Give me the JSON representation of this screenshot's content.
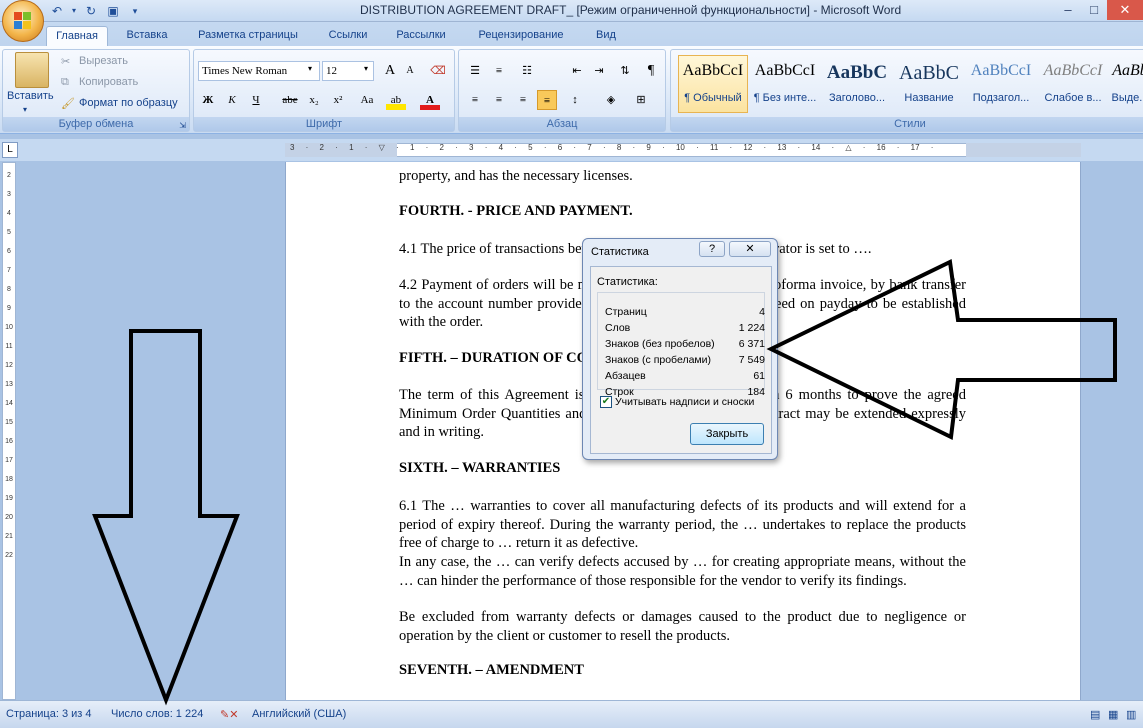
{
  "window": {
    "title": "DISTRIBUTION AGREEMENT DRAFT_ [Режим ограниченной функциональности] - Microsoft Word",
    "minimize_glyph": "–",
    "maximize_glyph": "□",
    "close_glyph": "✕"
  },
  "ribbon_tabs": [
    "Главная",
    "Вставка",
    "Разметка страницы",
    "Ссылки",
    "Рассылки",
    "Рецензирование",
    "Вид"
  ],
  "clipboard": {
    "paste": "Вставить",
    "cut": "Вырезать",
    "copy": "Копировать",
    "format_painter": "Формат по образцу",
    "group_label": "Буфер обмена"
  },
  "font": {
    "family": "Times New Roman",
    "size": "12",
    "group_label": "Шрифт",
    "bold": "Ж",
    "italic": "К",
    "underline": "Ч",
    "strike": "abe",
    "subscript": "x₂",
    "superscript": "x²",
    "change_case": "Aa",
    "grow": "A",
    "shrink": "A"
  },
  "paragraph": {
    "group_label": "Абзац",
    "pilcrow": "¶"
  },
  "styles": {
    "group_label": "Стили",
    "items": [
      {
        "preview": "AaBbCcI",
        "name": "¶ Обычный"
      },
      {
        "preview": "AaBbCcI",
        "name": "¶ Без инте..."
      },
      {
        "preview": "AaBbC",
        "name": "Заголово..."
      },
      {
        "preview": "AaBbC",
        "name": "Название"
      },
      {
        "preview": "AaBbCcI",
        "name": "Подзагол..."
      },
      {
        "preview": "AaBbCcI",
        "name": "Слабое в..."
      },
      {
        "preview": "AaBb",
        "name": "Выде..."
      }
    ]
  },
  "ruler": {
    "tab_selector": "L",
    "horizontal_ticks": "3 · 2 · 1 · ▽ · 1 · 2 · 3 · 4 · 5 · 6 · 7 · 8 · 9 · 10 · 11 · 12 · 13 · 14 · △ · 16 · 17 ·",
    "vertical_ticks": [
      "2",
      "3",
      "4",
      "5",
      "6",
      "7",
      "8",
      "9",
      "10",
      "11",
      "12",
      "13",
      "14",
      "15",
      "16",
      "17",
      "18",
      "19",
      "20",
      "21",
      "22"
    ]
  },
  "document": {
    "p_top": "property, and has the necessary licenses.",
    "h4": "FOURTH. - PRICE AND PAYMENT.",
    "p41": "4.1 The price of transactions between Distributor and Manufacturator is set to ….",
    "p42": "4.2 Payment of orders will be made in advance, based on the proforma invoice, by bank transfer to the account number provided by the Manufacturer when agreed on payday to be established with the order.",
    "h5": "FIFTH. – DURATION OF CONTRACT",
    "p5": "The term of this Agreement is …, with the obligation of each 6 months to prove the agreed Minimum Order Quantities and the … of spare parts. The Contract may be extended expressly and in writing.",
    "h6": "SIXTH. – WARRANTIES",
    "p61": "6.1 The … warranties to cover all manufacturing defects of its products and will extend for a period of expiry thereof. During the warranty period, the … undertakes to replace the products free of charge to … return it as defective.",
    "p62": "In any case, the … can verify defects accused by … for creating appropriate means, without the … can hinder the performance of those responsible for the vendor to verify its findings.",
    "p63": "Be excluded from warranty defects or damages caused to the product due to negligence or operation by the client or customer to resell the products.",
    "h7": "SEVENTH. – AMENDMENT"
  },
  "stats_dialog": {
    "title": "Статистика",
    "help": "?",
    "close": "✕",
    "section_label": "Статистика:",
    "rows": [
      {
        "label": "Страниц",
        "value": "4"
      },
      {
        "label": "Слов",
        "value": "1 224"
      },
      {
        "label": "Знаков (без пробелов)",
        "value": "6 371"
      },
      {
        "label": "Знаков (с пробелами)",
        "value": "7 549"
      },
      {
        "label": "Абзацев",
        "value": "61"
      },
      {
        "label": "Строк",
        "value": "184"
      }
    ],
    "include_textboxes": "Учитывать надписи и сноски",
    "include_checked": true,
    "close_button": "Закрыть"
  },
  "statusbar": {
    "page": "Страница: 3 из 4",
    "words": "Число слов: 1 224",
    "language": "Английский (США)"
  }
}
